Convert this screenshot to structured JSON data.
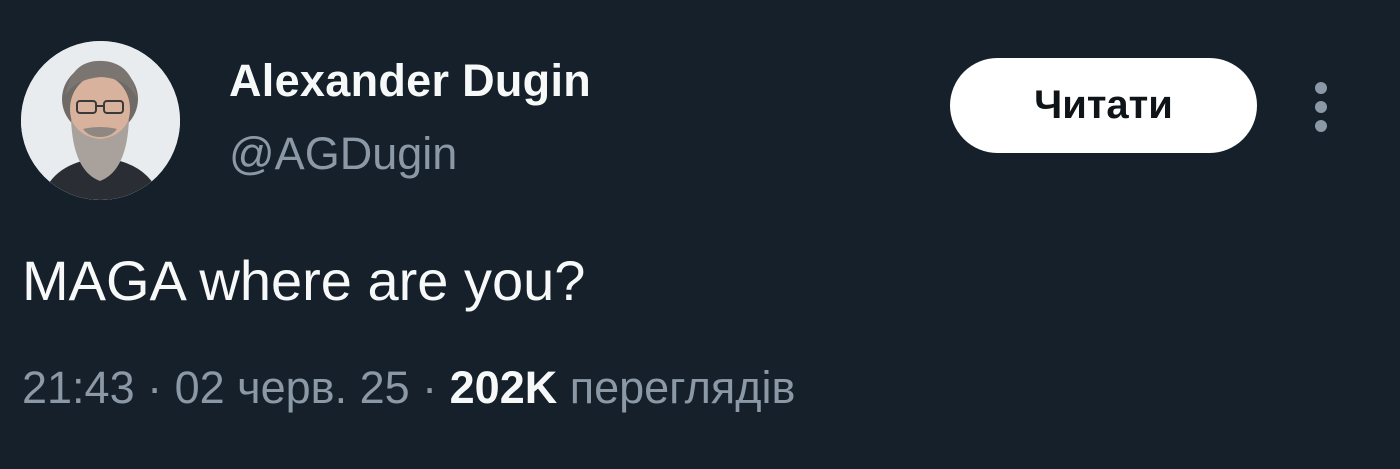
{
  "tweet": {
    "author": {
      "display_name": "Alexander Dugin",
      "handle": "@AGDugin",
      "avatar": "bearded-man-avatar"
    },
    "follow_label": "Читати",
    "more_icon": "more-vertical-icon",
    "text": "MAGA where are you?",
    "time": "21:43",
    "separator": " · ",
    "date": "02 черв. 25",
    "views_count": "202K",
    "views_label": " переглядів"
  },
  "colors": {
    "background": "#15202b",
    "primary_text": "#f7f9f9",
    "secondary_text": "#8b98a5",
    "button_bg": "#ffffff",
    "button_text": "#0f1419"
  }
}
